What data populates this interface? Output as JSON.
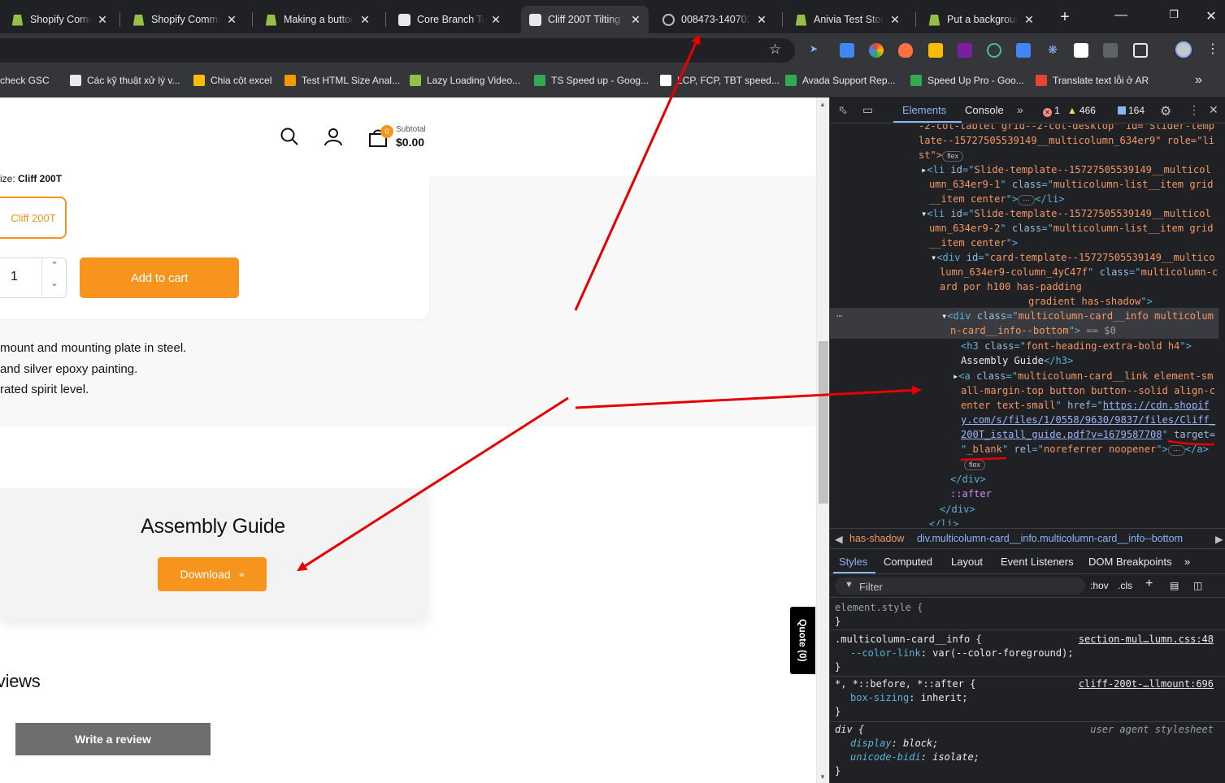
{
  "tabs": [
    {
      "title": "Shopify Commun",
      "favicon": "shopify-icon",
      "active": false
    },
    {
      "title": "Shopify Commun",
      "favicon": "shopify-icon",
      "active": false
    },
    {
      "title": "Making a button",
      "favicon": "shopify-icon",
      "active": false
    },
    {
      "title": "Core Branch Table",
      "favicon": "lock-icon",
      "active": false
    },
    {
      "title": "Cliff 200T Tilting \\",
      "favicon": "lock-icon",
      "active": true
    },
    {
      "title": "008473-140702_I",
      "favicon": "globe-icon",
      "active": false
    },
    {
      "title": "Anivia Test Store",
      "favicon": "shopify-icon",
      "active": false
    },
    {
      "title": "Put a background",
      "favicon": "shopify-icon",
      "active": false
    }
  ],
  "bookmarks": [
    {
      "label": "check GSC",
      "color": "#e8eaed"
    },
    {
      "label": "Các kỹ thuật xử lý v...",
      "color": "#e8eaed"
    },
    {
      "label": "Chia cột excel",
      "color": "#fbbc04"
    },
    {
      "label": "Test HTML Size Anal...",
      "color": "#f29900"
    },
    {
      "label": "Lazy Loading Video...",
      "color": "#95bf47"
    },
    {
      "label": "TS Speed up - Goog...",
      "color": "#34a853"
    },
    {
      "label": "LCP, FCP, TBT speed...",
      "color": "#ffffff"
    },
    {
      "label": "Avada Support Rep...",
      "color": "#34a853"
    },
    {
      "label": "Speed Up Pro - Goo...",
      "color": "#34a853"
    },
    {
      "label": "Translate text lỗi ở AR",
      "color": "#ea4335"
    }
  ],
  "store": {
    "cart_count": "0",
    "subtotal_label": "Subtotal",
    "subtotal_value": "$0.00",
    "size_label": "ize: ",
    "size_value": "Cliff 200T",
    "variant": "Cliff 200T",
    "quantity": "1",
    "add_to_cart": "Add to cart",
    "desc_lines": [
      "mount and mounting plate in steel.",
      " and silver epoxy painting.",
      "rated spirit level."
    ],
    "guide_title": "Assembly Guide",
    "download": "Download",
    "reviews_heading": "eviews",
    "write_review": "Write a review",
    "quote_tab": "Quote (0)"
  },
  "devtools": {
    "tabs": [
      "Elements",
      "Console"
    ],
    "errors": "1",
    "warnings": "466",
    "issues": "164",
    "breadcrumbs": [
      "has-shadow",
      "div.multicolumn-card__info.multicolumn-card__info--bottom"
    ],
    "sub_tabs": [
      "Styles",
      "Computed",
      "Layout",
      "Event Listeners",
      "DOM Breakpoints"
    ],
    "filter_placeholder": "Filter",
    "hov": ":hov",
    "cls": ".cls",
    "dom": {
      "l0": "-2-col-tablet grid--2-col-desktop\" id=\"Slider-temp",
      "l1": "late--15727505539149__multicolumn_634er9\" role=\"li",
      "l2a": "st\">",
      "li1_id": "Slide-template--15727505539149__multicol",
      "li1_id2": "umn_634er9-1",
      "li_class": "multicolumn-list__item grid",
      "li_class2": "__item center",
      "li2_id": "Slide-template--15727505539149__multicol",
      "li2_id2": "umn_634er9-2",
      "div_id": "card-template--15727505539149__multico",
      "div_id2": "lumn_634er9-column_4yC47f",
      "div_class": "multicolumn-c",
      "div_class2": "ard por h100 has-padding",
      "div_class3": "gradient has-shadow",
      "sel_class": "multicolumn-card__info multicolum",
      "sel_class2": "n-card__info--bottom",
      "sel_eq": " == $0",
      "h3_class": "font-heading-extra-bold h4",
      "h3_text": "Assembly Guide",
      "a_class": "multicolumn-card__link element-sm",
      "a_class2": "all-margin-top button button--solid align-c",
      "a_class3": "enter text-small",
      "href1": "https://cdn.shopif",
      "href2": "y.com/s/files/1/0558/9630/9837/files/Cliff_",
      "href3": "200T_istall_guide.pdf?v=1679587708",
      "target_attr": "target=",
      "target_val": "_blank",
      "rel_val": "noreferrer noopener",
      "flex": "flex",
      "after": "::after"
    },
    "styles": {
      "element_style": "element.style {",
      "r1_sel": ".multicolumn-card__info {",
      "r1_src": "section-mul…lumn.css:48",
      "r1_prop": "--color-link",
      "r1_val": "var(--color-foreground);",
      "r2_sel": "*, *::before, *::after {",
      "r2_src": "cliff-200t-…llmount:696",
      "r2_prop": "box-sizing",
      "r2_val": "inherit;",
      "r3_sel": "div {",
      "r3_src": "user agent stylesheet",
      "r3_p1": "display",
      "r3_v1": "block;",
      "r3_p2": "unicode-bidi",
      "r3_v2": "isolate;",
      "close": "}"
    }
  },
  "colors": {
    "accent": "#f7941d",
    "annotation": "#e60000",
    "devtools_link": "#8ab4f8"
  }
}
